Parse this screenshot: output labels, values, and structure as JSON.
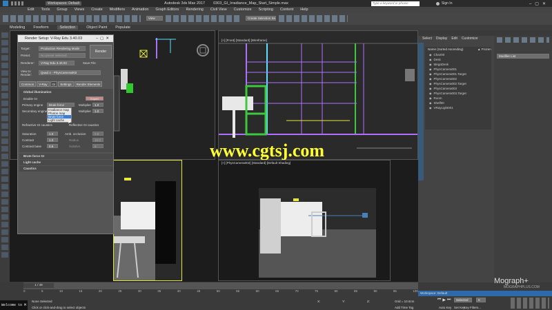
{
  "titlebar": {
    "workspace": "Workspaces: Default",
    "app_title": "Autodesk 3ds Max 2017",
    "file": "0303_GI_Irradiance_Map_Start_Simple.max",
    "search_placeholder": "Type a keyword or phrase",
    "user": "Sign In"
  },
  "menu": [
    "Edit",
    "Tools",
    "Group",
    "Views",
    "Create",
    "Modifiers",
    "Animation",
    "Graph Editors",
    "Rendering",
    "Civil View",
    "Customize",
    "Scripting",
    "Content",
    "Help"
  ],
  "toolbar": {
    "view_dropdown": "View",
    "selection_set": "Create Selection Se"
  },
  "ribbon_tabs": [
    "Modeling",
    "Freeform",
    "Selection",
    "Object Paint",
    "Populate"
  ],
  "viewports": {
    "top_right_label": "[+] [Front] [Standard] [Wireframe]",
    "bottom_right_label": "[+] [PhysCamera002] [Standard] [Default Shading]"
  },
  "watermark": "www.cgtsj.com",
  "render_setup": {
    "title": "Render Setup: V-Ray Edu 3.40.03",
    "target_label": "Target:",
    "target_value": "Production Rendering Mode",
    "preset_label": "Preset:",
    "preset_value": "No preset selected",
    "renderer_label": "Renderer:",
    "renderer_value": "V-Ray Edu 3.40.03",
    "save_file": "Save File",
    "view_label": "View to Render:",
    "view_value": "Quad 4 - PhysCamera002",
    "render_button": "Render",
    "tabs": [
      "Common",
      "V-Ray",
      "GI",
      "Settings",
      "Render Elements"
    ],
    "gi_section": "Global illumination",
    "enable_gi": "Enable GI",
    "expert": "Expert",
    "primary_label": "Primary engine",
    "primary_value": "Brute force",
    "multiplier_label": "Multiplier",
    "multiplier_value1": "1.0",
    "secondary_label": "Secondary engine",
    "multiplier_value2": "1.0",
    "dropdown_options": [
      "Irradiance map",
      "Photon map",
      "Brute force",
      "Light cache"
    ],
    "refractive": "Refractive GI caustics",
    "reflective": "Reflective GI caustics",
    "saturation_label": "Saturation",
    "saturation_value": "1.0",
    "ao_label": "Amb. occlusion",
    "ao_value": "0.8",
    "contrast_label": "Contrast",
    "contrast_value": "1.0",
    "radius_label": "Radius",
    "radius_value": "10.0",
    "contrast_base_label": "Contrast base",
    "contrast_base_value": "0.5",
    "subdivs_label": "Subdivs",
    "subdivs_value": "8",
    "rollouts": [
      "Brute force GI",
      "Light cache",
      "Caustics"
    ]
  },
  "command_panel": {
    "tabs": [
      "Select",
      "Display",
      "Edit",
      "Customize"
    ],
    "modifier_list": "Modifier List",
    "scene_header": "Name (Sorted Ascending)",
    "frozen_header": "▲ Frozen",
    "scene_items": [
      "Chair00",
      "Desk",
      "MegaDesk",
      "PhysCamera001",
      "PhysCamera001.Target",
      "PhysCamera002",
      "PhysCamera002.Target",
      "PhysCamera003",
      "PhysCamera003.Target",
      "Room",
      "Shelf00",
      "VRayLight001"
    ]
  },
  "statusbar": {
    "script_prompt": "Welcome to M",
    "selection_status": "None Selected",
    "hint": "Click or click-and-drag to select objects",
    "timeline_frame": "1 / 49",
    "x_label": "X:",
    "y_label": "Y:",
    "z_label": "Z:",
    "grid": "Grid = 10.0cm",
    "add_time_tag": "Add Time Tag",
    "auto_key": "Auto Key",
    "set_key": "Set Key",
    "selected": "Selected",
    "key_filters": "Key Filters...",
    "frame_value": "0",
    "workspace_label": "Workspace: Default"
  },
  "brand": {
    "logo": "Mograph+",
    "sub": "MOGRAPHPLUS.COM"
  },
  "ticks": [
    "0",
    "5",
    "10",
    "15",
    "20",
    "25",
    "30",
    "35",
    "40",
    "45",
    "50",
    "55",
    "60",
    "65",
    "70",
    "75",
    "80",
    "85",
    "90",
    "95",
    "100"
  ],
  "colors": {
    "accent_blue": "#4a7fb8",
    "watermark_yellow": "#ffff33",
    "wire_green": "#3ec83e",
    "wire_cyan": "#5ee0ff",
    "wire_purple": "#b070ff",
    "wire_yellow": "#e8e840"
  }
}
